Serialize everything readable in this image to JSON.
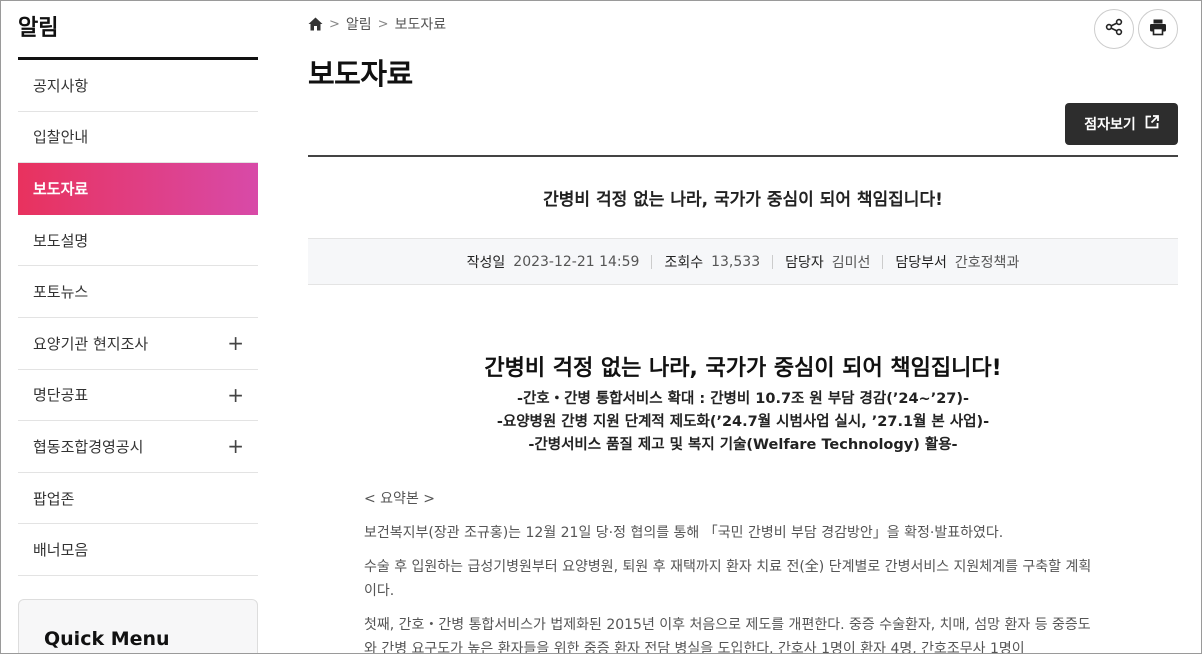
{
  "sidebar": {
    "title": "알림",
    "items": [
      {
        "label": "공지사항"
      },
      {
        "label": "입찰안내"
      },
      {
        "label": "보도자료"
      },
      {
        "label": "보도설명"
      },
      {
        "label": "포토뉴스"
      },
      {
        "label": "요양기관 현지조사"
      },
      {
        "label": "명단공표"
      },
      {
        "label": "협동조합경영공시"
      },
      {
        "label": "팝업존"
      },
      {
        "label": "배너모음"
      }
    ],
    "expand_symbol": "+",
    "quick_menu_title": "Quick Menu"
  },
  "breadcrumb": {
    "items": [
      "알림",
      "보도자료"
    ],
    "separator": ">"
  },
  "page": {
    "title": "보도자료",
    "braille_label": "점자보기"
  },
  "post": {
    "title": "간병비 걱정 없는 나라, 국가가 중심이 되어 책임집니다!",
    "meta": {
      "date_label": "작성일",
      "date": "2023-12-21 14:59",
      "views_label": "조회수",
      "views": "13,533",
      "author_label": "담당자",
      "author": "김미선",
      "dept_label": "담당부서",
      "dept": "간호정책과"
    },
    "headline": "간병비 걱정 없는 나라, 국가가 중심이 되어 책임집니다!",
    "subheads": [
      "-간호・간병 통합서비스 확대 : 간병비 10.7조 원 부담 경감(’24~’27)-",
      "-요양병원 간병 지원 단계적 제도화(’24.7월 시범사업 실시, ’27.1월 본 사업)-",
      "-간병서비스 품질 제고 및 복지 기술(Welfare Technology) 활용-"
    ],
    "paragraphs": [
      "< 요약본 >",
      "보건복지부(장관 조규홍)는 12월 21일 당·정 협의를 통해 「국민 간병비 부담 경감방안」을 확정·발표하였다.",
      "수술 후 입원하는 급성기병원부터 요양병원, 퇴원 후 재택까지 환자 치료 전(全) 단계별로 간병서비스 지원체계를 구축할 계획이다.",
      "첫째, 간호・간병 통합서비스가 법제화된 2015년 이후 처음으로 제도를 개편한다. 중증 수술환자, 치매, 섬망 환자 등 중증도와 간병 요구도가 높은 환자들을 위한 중증 환자 전담 병실을 도입한다. 간호사 1명이 환자 4명, 간호조무사 1명이"
    ]
  },
  "colors": {
    "accent_start": "#e8325e",
    "accent_end": "#d84aa8",
    "dark_button": "#2d2d2d"
  }
}
